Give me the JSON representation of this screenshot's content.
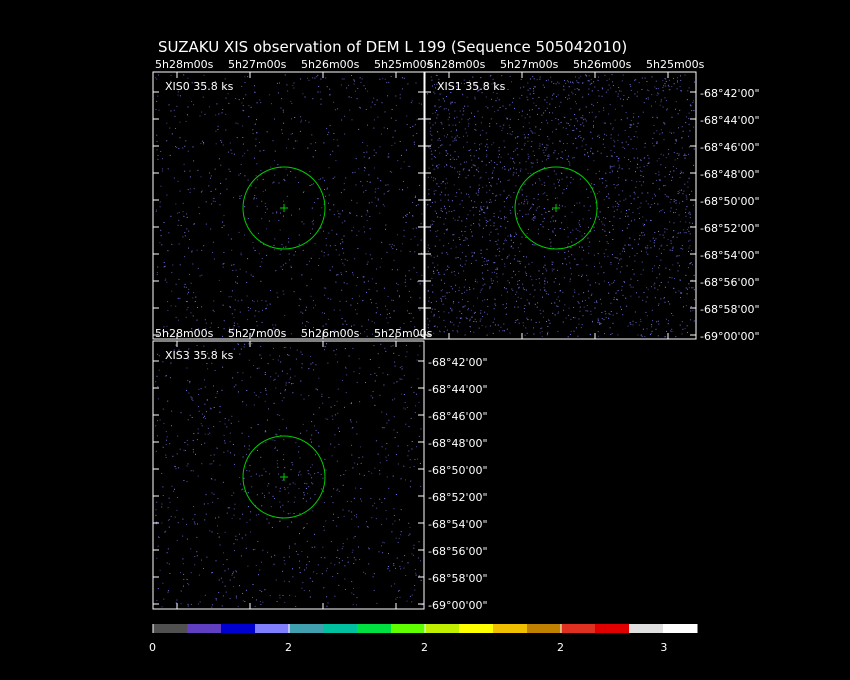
{
  "title": "SUZAKU XIS observation of DEM L 199  (Sequence 505042010)",
  "chart_data": {
    "type": "heatmap",
    "title": "SUZAKU XIS observation of DEM L 199  (Sequence 505042010)",
    "colors": {
      "background": "#000000",
      "frame": "#ffffff",
      "region": "#00cc00",
      "events": "#8080ff"
    },
    "ra_ticks": [
      "5h28m00s",
      "5h27m00s",
      "5h26m00s",
      "5h25m00s"
    ],
    "dec_ticks": [
      "-68°42'00\"",
      "-68°44'00\"",
      "-68°46'00\"",
      "-68°48'00\"",
      "-68°50'00\"",
      "-68°52'00\"",
      "-68°54'00\"",
      "-68°56'00\"",
      "-68°58'00\"",
      "-69°00'00\""
    ],
    "panels": [
      {
        "name": "XIS0",
        "label": "XIS0  35.8 ks",
        "density": 0.45
      },
      {
        "name": "XIS1",
        "label": "XIS1  35.8 ks",
        "density": 1.0
      },
      {
        "name": "XIS3",
        "label": "XIS3  35.8 ks",
        "density": 0.45
      }
    ],
    "colorbar": {
      "colors": [
        "#505050",
        "#6040c0",
        "#0000d0",
        "#8080ff",
        "#40a0b0",
        "#00c0a0",
        "#00e040",
        "#60ff00",
        "#c0f000",
        "#ffff00",
        "#f0c000",
        "#c08000",
        "#e03020",
        "#e00000",
        "#e0e0e0",
        "#ffffff"
      ],
      "tick_labels": [
        "0",
        "2",
        "2",
        "2",
        "3"
      ]
    }
  }
}
